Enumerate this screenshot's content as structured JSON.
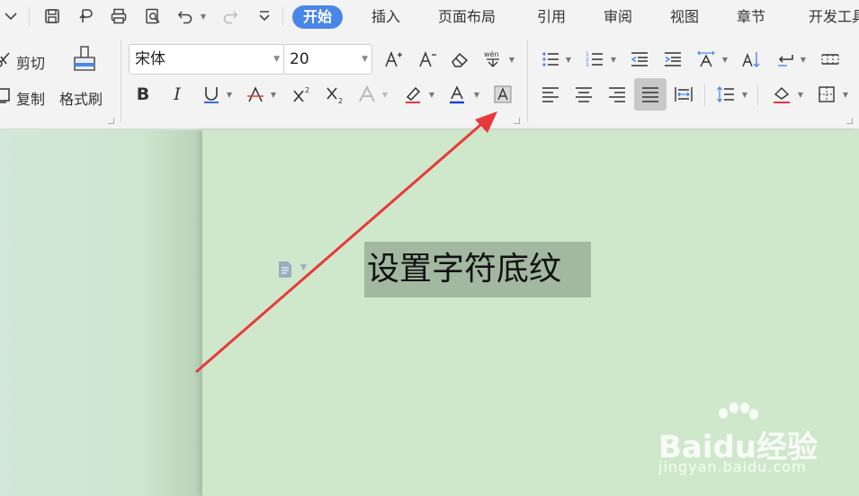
{
  "tabs": [
    {
      "label": "开始",
      "active": true
    },
    {
      "label": "插入"
    },
    {
      "label": "页面布局"
    },
    {
      "label": "引用"
    },
    {
      "label": "审阅"
    },
    {
      "label": "视图"
    },
    {
      "label": "章节"
    },
    {
      "label": "开发工具"
    }
  ],
  "clipboard": {
    "cut_label": "剪切",
    "copy_label": "复制",
    "format_painter_label": "格式刷"
  },
  "font": {
    "name": "宋体",
    "size": "20"
  },
  "document": {
    "selected_text": "设置字符底纹"
  },
  "watermark": {
    "logo": "Baidu经验",
    "url": "jingyan.baidu.com"
  },
  "colors": {
    "accent": "#4a86e8",
    "page": "#cfe8cb",
    "highlight": "#a2b8a0",
    "arrow": "#e8393a",
    "underline_blue": "#1a5fd6"
  }
}
